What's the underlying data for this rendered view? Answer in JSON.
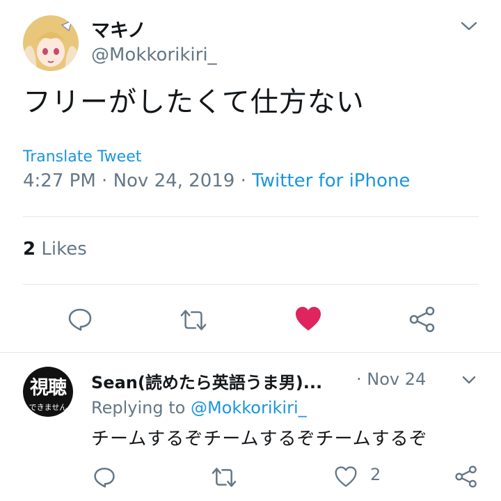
{
  "tweet": {
    "display_name": "マキノ",
    "handle": "@Mokkorikiri_",
    "text": "フリーがしたくて仕方ない",
    "translate_label": "Translate Tweet",
    "time": "4:27 PM",
    "date": "Nov 24, 2019",
    "separator": "·",
    "source": "Twitter for iPhone",
    "likes_count": "2",
    "likes_label": "Likes",
    "actions": [
      {
        "name": "reply-icon"
      },
      {
        "name": "retweet-icon"
      },
      {
        "name": "heart-icon",
        "liked": true
      },
      {
        "name": "share-icon"
      }
    ]
  },
  "reply": {
    "display_name": "Sean(読めたら英語うま男)...",
    "date": "· Nov 24",
    "replying_prefix": "Replying to",
    "replying_mention": "@Mokkorikiri_",
    "text": "チームするぞチームするぞチームするぞ",
    "avatar_text_big": "視聴",
    "avatar_text_small": "できません",
    "like_count": "2"
  },
  "colors": {
    "link": "#1b95e0",
    "secondary_text": "#657786",
    "like_active": "#e0245e",
    "divider": "#e1e8ed"
  }
}
